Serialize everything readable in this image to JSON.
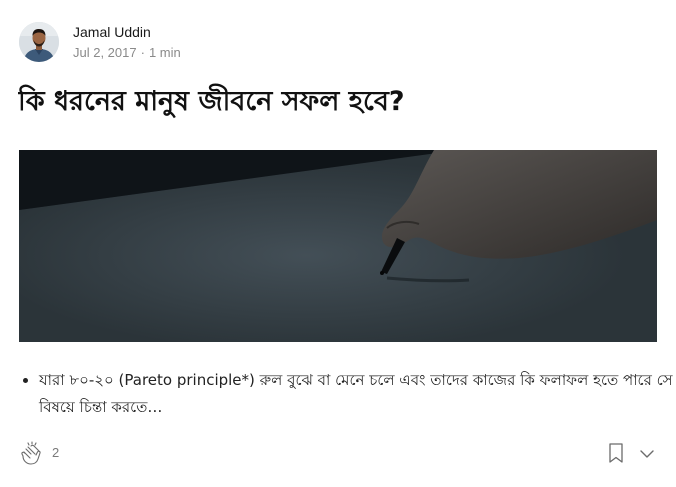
{
  "author": {
    "name": "Jamal Uddin",
    "date": "Jul 2, 2017",
    "separator": "·",
    "read_time": "1 min"
  },
  "post": {
    "title": "কি ধরনের মানুষ জীবনে সফল হবে?",
    "excerpt": "যারা ৮০-২০ (Pareto principle*) রুল বুঝে বা মেনে চলে এবং তাদের কাজের কি ফলাফল হতে পারে সে বিষয়ে চিন্তা করতে…"
  },
  "footer": {
    "clap_count": "2"
  },
  "icons": {
    "clap": "clap-icon",
    "bookmark": "bookmark-icon",
    "more": "chevron-down-icon"
  },
  "colors": {
    "text_primary": "#1a1a1a",
    "text_muted": "#8a8a8a",
    "icon_gray": "#6b6b6b"
  }
}
